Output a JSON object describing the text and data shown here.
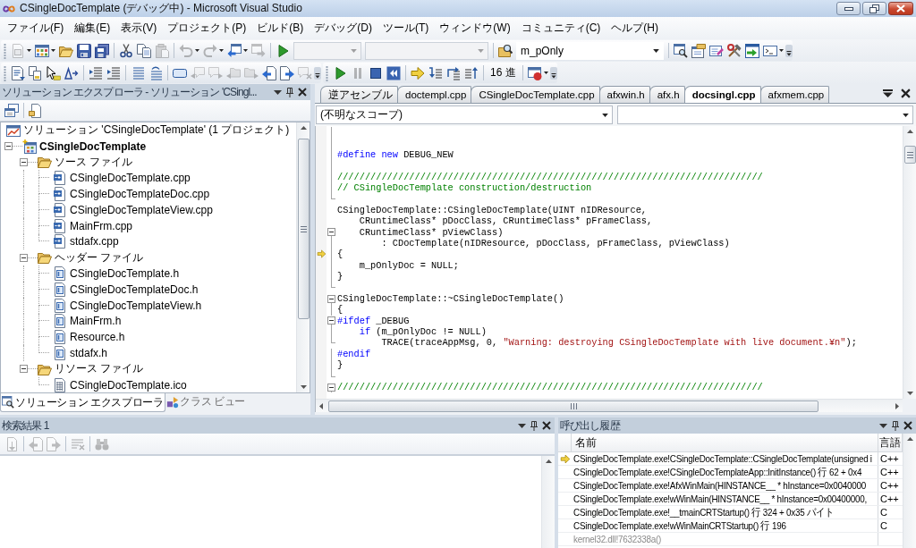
{
  "window": {
    "title": "CSingleDocTemplate (デバッグ中) - Microsoft Visual Studio"
  },
  "menu": [
    "ファイル(F)",
    "編集(E)",
    "表示(V)",
    "プロジェクト(P)",
    "ビルド(B)",
    "デバッグ(D)",
    "ツール(T)",
    "ウィンドウ(W)",
    "コミュニティ(C)",
    "ヘルプ(H)"
  ],
  "toolbar_standard": [
    {
      "kind": "button",
      "disabled": true,
      "dropdown": true
    },
    {
      "kind": "button",
      "disabled": false,
      "dropdown": true
    },
    {
      "kind": "button",
      "disabled": false,
      "dropdown": false
    },
    {
      "kind": "button",
      "disabled": false,
      "dropdown": false
    },
    {
      "kind": "button",
      "disabled": false,
      "dropdown": false
    },
    {
      "kind": "separator"
    },
    {
      "kind": "button",
      "disabled": false,
      "dropdown": false
    },
    {
      "kind": "button",
      "disabled": false,
      "dropdown": false
    },
    {
      "kind": "button",
      "disabled": true,
      "dropdown": false
    },
    {
      "kind": "separator"
    },
    {
      "kind": "button",
      "disabled": true,
      "dropdown": true
    },
    {
      "kind": "button",
      "disabled": true,
      "dropdown": true
    },
    {
      "kind": "button",
      "disabled": false,
      "dropdown": true
    },
    {
      "kind": "button",
      "disabled": true,
      "dropdown": false
    },
    {
      "kind": "separator"
    },
    {
      "kind": "button",
      "disabled": false,
      "dropdown": false
    },
    {
      "kind": "combo",
      "disabled": true
    },
    {
      "kind": "combo",
      "disabled": true
    },
    {
      "kind": "separator"
    },
    {
      "kind": "button",
      "disabled": false,
      "dropdown": false
    },
    {
      "kind": "combo",
      "disabled": false,
      "value": "m_pOnly"
    },
    {
      "kind": "separator"
    },
    {
      "kind": "button",
      "disabled": false,
      "dropdown": false
    },
    {
      "kind": "button",
      "disabled": false,
      "dropdown": false
    },
    {
      "kind": "button",
      "disabled": false,
      "dropdown": false
    },
    {
      "kind": "button",
      "disabled": false,
      "dropdown": false
    },
    {
      "kind": "button",
      "disabled": false,
      "dropdown": false
    },
    {
      "kind": "button",
      "disabled": false,
      "dropdown": true
    }
  ],
  "toolbar_text_editor": [
    {
      "kind": "button",
      "disabled": false,
      "dropdown": false
    },
    {
      "kind": "button",
      "disabled": false,
      "dropdown": false
    },
    {
      "kind": "button",
      "disabled": false,
      "dropdown": false
    },
    {
      "kind": "button",
      "disabled": false,
      "dropdown": false
    },
    {
      "kind": "separator"
    },
    {
      "kind": "button",
      "disabled": false,
      "dropdown": false
    },
    {
      "kind": "button",
      "disabled": false,
      "dropdown": false
    },
    {
      "kind": "separator"
    },
    {
      "kind": "button",
      "disabled": false,
      "dropdown": false
    },
    {
      "kind": "button",
      "disabled": false,
      "dropdown": false
    },
    {
      "kind": "separator"
    },
    {
      "kind": "button",
      "disabled": false,
      "dropdown": false
    },
    {
      "kind": "button",
      "disabled": true,
      "dropdown": false
    },
    {
      "kind": "button",
      "disabled": true,
      "dropdown": false
    },
    {
      "kind": "button",
      "disabled": true,
      "dropdown": false
    },
    {
      "kind": "button",
      "disabled": true,
      "dropdown": false
    },
    {
      "kind": "button",
      "disabled": false,
      "dropdown": false
    },
    {
      "kind": "button",
      "disabled": false,
      "dropdown": false
    },
    {
      "kind": "button",
      "disabled": true,
      "dropdown": false
    }
  ],
  "toolbar_debug": [
    {
      "kind": "button",
      "disabled": false,
      "dropdown": false
    },
    {
      "kind": "button",
      "disabled": true,
      "dropdown": false
    },
    {
      "kind": "button",
      "disabled": false,
      "dropdown": false
    },
    {
      "kind": "button",
      "disabled": false,
      "dropdown": false
    },
    {
      "kind": "separator"
    },
    {
      "kind": "button",
      "disabled": false,
      "dropdown": false
    },
    {
      "kind": "button",
      "disabled": false,
      "dropdown": false
    },
    {
      "kind": "button",
      "disabled": false,
      "dropdown": false
    },
    {
      "kind": "button",
      "disabled": false,
      "dropdown": false
    },
    {
      "kind": "separator"
    },
    {
      "kind": "text",
      "label": "16 進"
    },
    {
      "kind": "separator"
    },
    {
      "kind": "button",
      "disabled": false,
      "dropdown": true
    }
  ],
  "solution_explorer": {
    "title": "ソリューション エクスプローラ - ソリューション 'CSingl...",
    "toolbar": [
      {
        "kind": "button",
        "disabled": false,
        "dropdown": false
      },
      {
        "kind": "separator"
      },
      {
        "kind": "button",
        "disabled": false,
        "dropdown": false
      }
    ],
    "tree": [
      {
        "label": "ソリューション 'CSingleDocTemplate' (1 プロジェクト)",
        "kind": "solution",
        "children": [
          {
            "label": "CSingleDocTemplate",
            "kind": "project",
            "expanded": true,
            "children": [
              {
                "label": "ソース ファイル",
                "kind": "folder",
                "expanded": true,
                "children": [
                  {
                    "label": "CSingleDocTemplate.cpp",
                    "kind": "source"
                  },
                  {
                    "label": "CSingleDocTemplateDoc.cpp",
                    "kind": "source"
                  },
                  {
                    "label": "CSingleDocTemplateView.cpp",
                    "kind": "source"
                  },
                  {
                    "label": "MainFrm.cpp",
                    "kind": "source"
                  },
                  {
                    "label": "stdafx.cpp",
                    "kind": "source"
                  }
                ]
              },
              {
                "label": "ヘッダー ファイル",
                "kind": "folder",
                "expanded": true,
                "children": [
                  {
                    "label": "CSingleDocTemplate.h",
                    "kind": "header"
                  },
                  {
                    "label": "CSingleDocTemplateDoc.h",
                    "kind": "header"
                  },
                  {
                    "label": "CSingleDocTemplateView.h",
                    "kind": "header"
                  },
                  {
                    "label": "MainFrm.h",
                    "kind": "header"
                  },
                  {
                    "label": "Resource.h",
                    "kind": "header"
                  },
                  {
                    "label": "stdafx.h",
                    "kind": "header"
                  }
                ]
              },
              {
                "label": "リソース ファイル",
                "kind": "folder",
                "expanded": true,
                "children": [
                  {
                    "label": "CSingleDocTemplate.ico",
                    "kind": "image"
                  }
                ]
              }
            ]
          }
        ]
      }
    ],
    "tabs": [
      {
        "label": "ソリューション エクスプローラ",
        "selected": true
      },
      {
        "label": "クラス ビュー",
        "selected": false
      }
    ]
  },
  "editor": {
    "tabs": [
      {
        "label": "逆アセンブル",
        "selected": false
      },
      {
        "label": "doctempl.cpp",
        "selected": false
      },
      {
        "label": "CSingleDocTemplate.cpp",
        "selected": false
      },
      {
        "label": "afxwin.h",
        "selected": false
      },
      {
        "label": "afx.h",
        "selected": false
      },
      {
        "label": "docsingl.cpp",
        "selected": true
      },
      {
        "label": "afxmem.cpp",
        "selected": false
      }
    ],
    "scope": "(不明なスコープ)",
    "lines": [
      {
        "kind": "fold",
        "current": false
      },
      {
        "kind": "fold",
        "current": false
      },
      {
        "kind": "fold",
        "current": false,
        "tokens": [
          {
            "kind": "keyword",
            "text": "#define new"
          },
          {
            "kind": "plain",
            "text": " DEBUG_NEW"
          }
        ]
      },
      {
        "kind": "fold",
        "current": false
      },
      {
        "kind": "fold",
        "current": false,
        "tokens": [
          {
            "kind": "comment",
            "text": "/////////////////////////////////////////////////////////////////////////////"
          }
        ]
      },
      {
        "kind": "fold",
        "current": false,
        "tokens": [
          {
            "kind": "comment",
            "text": "// CSingleDocTemplate construction/destruction"
          }
        ]
      },
      {
        "kind": "fold-end",
        "current": false
      },
      {
        "kind": "code",
        "current": false,
        "tokens": [
          {
            "kind": "plain",
            "text": "CSingleDocTemplate::CSingleDocTemplate(UINT nIDResource,"
          }
        ]
      },
      {
        "kind": "code",
        "current": false,
        "tokens": [
          {
            "kind": "plain",
            "text": "    CRuntimeClass* pDocClass, CRuntimeClass* pFrameClass,"
          }
        ]
      },
      {
        "kind": "fold-start",
        "current": false,
        "tokens": [
          {
            "kind": "plain",
            "text": "    CRuntimeClass* pViewClass)"
          }
        ]
      },
      {
        "kind": "fold",
        "current": false,
        "tokens": [
          {
            "kind": "plain",
            "text": "        : CDocTemplate(nIDResource, pDocClass, pFrameClass, pViewClass)"
          }
        ]
      },
      {
        "kind": "fold",
        "current": true,
        "tokens": [
          {
            "kind": "plain",
            "text": "{"
          }
        ]
      },
      {
        "kind": "fold",
        "current": false,
        "tokens": [
          {
            "kind": "plain",
            "text": "    m_pOnlyDoc = NULL;"
          }
        ]
      },
      {
        "kind": "fold",
        "current": false,
        "tokens": [
          {
            "kind": "plain",
            "text": "}"
          }
        ]
      },
      {
        "kind": "fold-end",
        "current": false
      },
      {
        "kind": "fold-start",
        "current": false,
        "tokens": [
          {
            "kind": "plain",
            "text": "CSingleDocTemplate::~CSingleDocTemplate()"
          }
        ]
      },
      {
        "kind": "fold",
        "current": false,
        "tokens": [
          {
            "kind": "plain",
            "text": "{"
          }
        ]
      },
      {
        "kind": "fold-start",
        "current": false,
        "tokens": [
          {
            "kind": "keyword",
            "text": "#ifdef"
          },
          {
            "kind": "plain",
            "text": " _DEBUG"
          }
        ]
      },
      {
        "kind": "fold",
        "current": false,
        "tokens": [
          {
            "kind": "keyword",
            "text": "    if"
          },
          {
            "kind": "plain",
            "text": " (m_pOnlyDoc != NULL)"
          }
        ]
      },
      {
        "kind": "fold-end",
        "current": false,
        "tokens": [
          {
            "kind": "plain",
            "text": "        TRACE(traceAppMsg, 0, "
          },
          {
            "kind": "string",
            "text": "\"Warning: destroying CSingleDocTemplate with live document.¥n\""
          },
          {
            "kind": "plain",
            "text": ");"
          }
        ]
      },
      {
        "kind": "fold",
        "current": false,
        "tokens": [
          {
            "kind": "keyword",
            "text": "#endif"
          }
        ]
      },
      {
        "kind": "fold",
        "current": false,
        "tokens": [
          {
            "kind": "plain",
            "text": "}"
          }
        ]
      },
      {
        "kind": "fold-end",
        "current": false
      },
      {
        "kind": "fold-start",
        "current": false,
        "tokens": [
          {
            "kind": "comment",
            "text": "/////////////////////////////////////////////////////////////////////////////"
          }
        ]
      }
    ]
  },
  "find_results": {
    "title": "検索結果 1",
    "toolbar": [
      {
        "kind": "button",
        "disabled": true,
        "dropdown": false
      },
      {
        "kind": "separator"
      },
      {
        "kind": "button",
        "disabled": true,
        "dropdown": false
      },
      {
        "kind": "button",
        "disabled": true,
        "dropdown": false
      },
      {
        "kind": "separator"
      },
      {
        "kind": "button",
        "disabled": true,
        "dropdown": false
      },
      {
        "kind": "separator"
      },
      {
        "kind": "button",
        "disabled": true,
        "dropdown": false
      }
    ]
  },
  "call_stack": {
    "title": "呼び出し履歴",
    "columns": [
      "名前",
      "言語"
    ],
    "rows": [
      {
        "name": "CSingleDocTemplate.exe!CSingleDocTemplate::CSingleDocTemplate(unsigned i",
        "language": "C++",
        "current": true,
        "disabled": false
      },
      {
        "name": "CSingleDocTemplate.exe!CSingleDocTemplateApp::InitInstance() 行 62 + 0x4",
        "language": "C++",
        "current": false,
        "disabled": false
      },
      {
        "name": "CSingleDocTemplate.exe!AfxWinMain(HINSTANCE__ * hInstance=0x0040000",
        "language": "C++",
        "current": false,
        "disabled": false
      },
      {
        "name": "CSingleDocTemplate.exe!wWinMain(HINSTANCE__ * hInstance=0x00400000,",
        "language": "C++",
        "current": false,
        "disabled": false
      },
      {
        "name": "CSingleDocTemplate.exe!__tmainCRTStartup() 行 324 + 0x35 バイト",
        "language": "C",
        "current": false,
        "disabled": false
      },
      {
        "name": "CSingleDocTemplate.exe!wWinMainCRTStartup() 行 196",
        "language": "C",
        "current": false,
        "disabled": false
      },
      {
        "name": "kernel32.dll!7632338a()",
        "current": false,
        "disabled": true
      }
    ]
  }
}
